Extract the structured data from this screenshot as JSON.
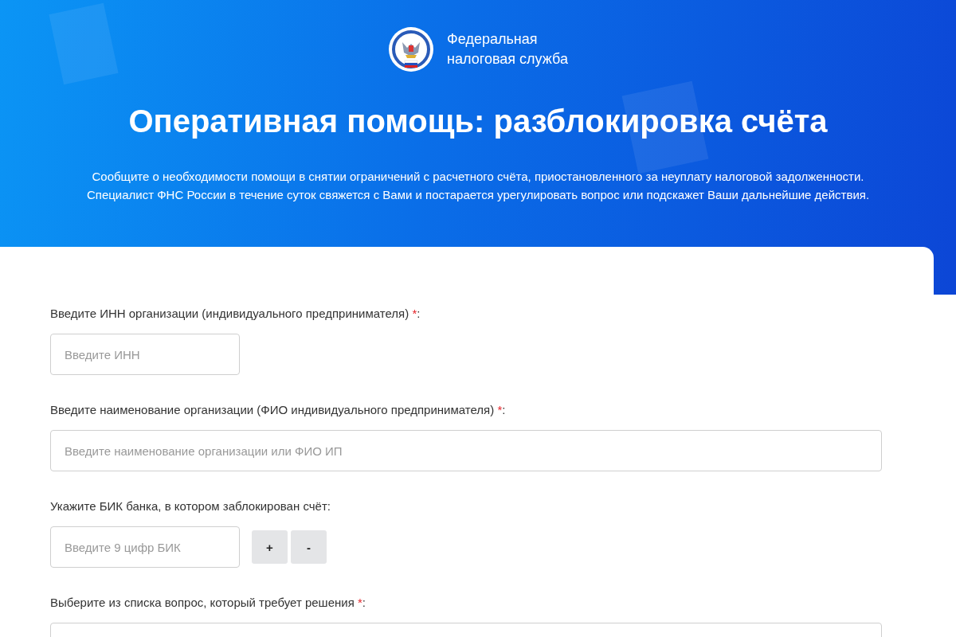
{
  "header": {
    "logo_text": [
      "Федеральная",
      "налоговая служба"
    ],
    "title": "Оперативная помощь: разблокировка счёта",
    "description": [
      "Сообщите о необходимости помощи в снятии ограничений с расчетного счёта, приостановленного за неуплату налоговой задолженности.",
      "Специалист ФНС России в течение суток свяжется с Вами и постарается урегулировать вопрос или подскажет Ваши дальнейшие действия."
    ]
  },
  "form": {
    "fields": [
      {
        "kind": "short",
        "label": "Введите ИНН организации (индивидуального предпринимателя) ",
        "required": true,
        "required_mark": "*",
        "suffix": ":",
        "placeholder": "Введите ИНН"
      },
      {
        "kind": "wide",
        "label": "Введите наименование организации (ФИО индивидуального предпринимателя) ",
        "required": true,
        "required_mark": "*",
        "suffix": ":",
        "placeholder": "Введите наименование организации или ФИО ИП"
      },
      {
        "kind": "short",
        "label": "Укажите БИК банка, в котором заблокирован счёт:",
        "required": false,
        "placeholder": "Введите 9 цифр БИК",
        "buttons": [
          "+",
          "-"
        ]
      },
      {
        "kind": "select",
        "label": "Выберите из списка вопрос, который требует решения ",
        "required": true,
        "required_mark": "*",
        "suffix": ":"
      }
    ]
  }
}
